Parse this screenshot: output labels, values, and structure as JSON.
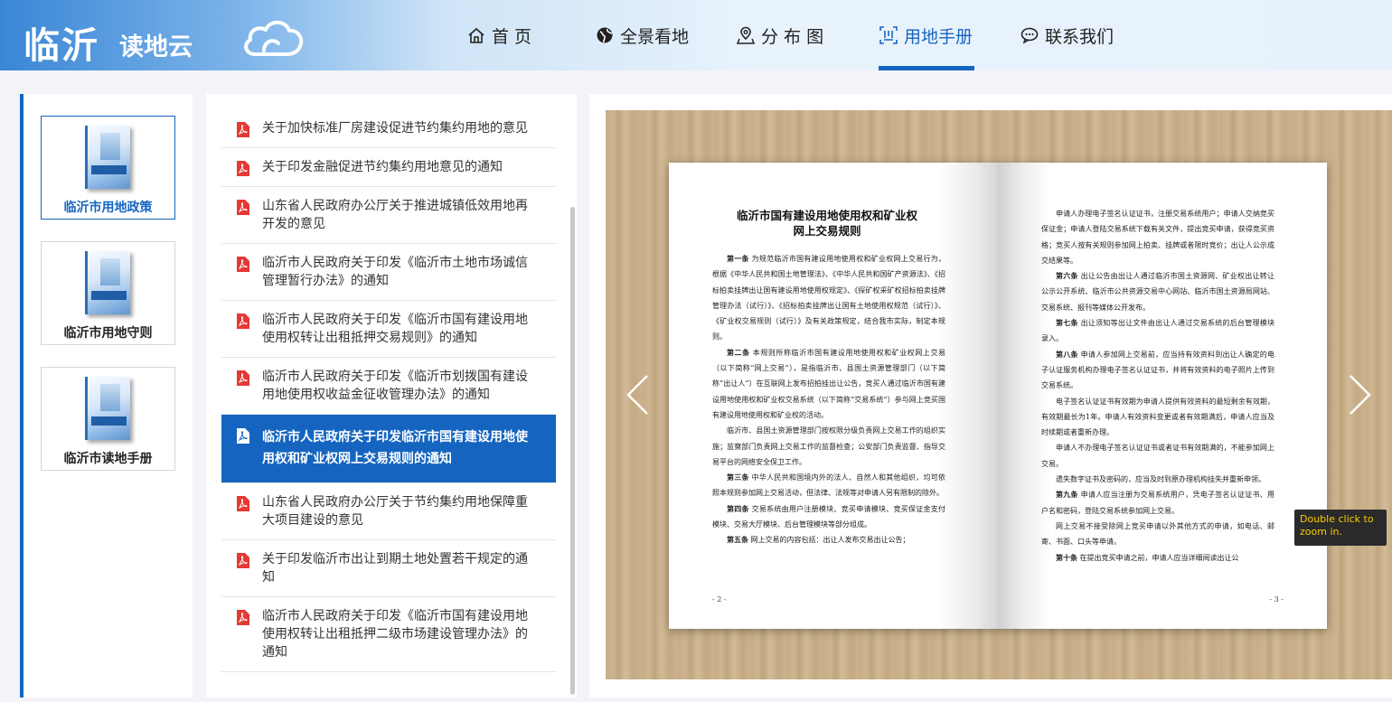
{
  "logo": {
    "main": "临沂",
    "sub": "读地云"
  },
  "nav": [
    {
      "label": "首 页",
      "icon": "home-icon"
    },
    {
      "label": "全景看地",
      "icon": "globe-icon"
    },
    {
      "label": "分 布 图",
      "icon": "location-pin-icon"
    },
    {
      "label": "用地手册",
      "icon": "book-scan-icon",
      "active": true
    },
    {
      "label": "联系我们",
      "icon": "chat-icon"
    }
  ],
  "categories": [
    {
      "label": "临沂市用地政策",
      "active": true
    },
    {
      "label": "临沂市用地守则"
    },
    {
      "label": "临沂市读地手册"
    }
  ],
  "documents": [
    {
      "title": "关于加快标准厂房建设促进节约集约用地的意见"
    },
    {
      "title": "关于印发金融促进节约集约用地意见的通知"
    },
    {
      "title": "山东省人民政府办公厅关于推进城镇低效用地再开发的意见"
    },
    {
      "title": "临沂市人民政府关于印发《临沂市土地市场诚信管理暂行办法》的通知"
    },
    {
      "title": "临沂市人民政府关于印发《临沂市国有建设用地使用权转让出租抵押交易规则》的通知"
    },
    {
      "title": "临沂市人民政府关于印发《临沂市划拨国有建设用地使用权收益金征收管理办法》的通知"
    },
    {
      "title": "临沂市人民政府关于印发临沂市国有建设用地使用权和矿业权网上交易规则的通知",
      "active": true
    },
    {
      "title": "山东省人民政府办公厅关于节约集约用地保障重大项目建设的意见"
    },
    {
      "title": "关于印发临沂市出让到期土地处置若干规定的通知"
    },
    {
      "title": "临沂市人民政府关于印发《临沂市国有建设用地使用权转让出租抵押二级市场建设管理办法》的通知"
    }
  ],
  "viewer": {
    "left_page": {
      "title_line1": "临沂市国有建设用地使用权和矿业权",
      "title_line2": "网上交易规则",
      "paragraphs": [
        {
          "lead": "第一条",
          "text": "为规范临沂市国有建设用地使用权和矿业权网上交易行为，根据《中华人民共和国土地管理法》、《中华人民共和国矿产资源法》、《招标拍卖挂牌出让国有建设用地使用权规定》、《探矿权采矿权招标拍卖挂牌管理办法（试行）》、《招标拍卖挂牌出让国有土地使用权规范（试行）》、《矿业权交易规则（试行）》及有关政策规定，结合我市实际，制定本规则。"
        },
        {
          "lead": "第二条",
          "text": "本规则所称临沂市国有建设用地使用权和矿业权网上交易（以下简称“网上交易”），是指临沂市、县国土资源管理部门（以下简称“出让人”）在互联网上发布招拍挂出让公告，竞买人通过临沂市国有建设用地使用权和矿业权交易系统（以下简称“交易系统”）参与网上竞买国有建设用地使用权和矿业权的活动。"
        },
        {
          "lead": "",
          "text": "临沂市、县国土资源管理部门按权限分级负责网上交易工作的组织实施；监察部门负责网上交易工作的监督检查；公安部门负责监督、指导交易平台的网络安全保卫工作。"
        },
        {
          "lead": "第三条",
          "text": "中华人民共和国境内外的法人、自然人和其他组织，均可依照本规则参加网上交易活动，但法律、法规等对申请人另有限制的除外。"
        },
        {
          "lead": "第四条",
          "text": "交易系统由用户注册模块、竞买申请模块、竞买保证金支付模块、交易大厅模块、后台管理模块等部分组成。"
        },
        {
          "lead": "第五条",
          "text": "网上交易的内容包括：出让人发布交易出让公告；"
        }
      ],
      "page_number": "- 2 -"
    },
    "right_page": {
      "paragraphs": [
        {
          "lead": "",
          "text": "申请人办理电子签名认证证书，注册交易系统用户；申请人交纳竞买保证金；申请人登陆交易系统下载有关文件，提出竞买申请，获得竞买资格；竞买人按有关规则参加网上拍卖、挂牌或者限时竞价；出让人公示成交结果等。"
        },
        {
          "lead": "第六条",
          "text": "出让公告由出让人通过临沂市国土资源网、矿业权出让转让公示公开系统、临沂市公共资源交易中心网站、临沂市国土资源局网站、交易系统、报刊等媒体公开发布。"
        },
        {
          "lead": "第七条",
          "text": "出让须知等出让文件由出让人通过交易系统的后台管理模块录入。"
        },
        {
          "lead": "第八条",
          "text": "申请人参加网上交易前，应当持有效资料到出让人确定的电子认证服务机构办理电子签名认证证书，并将有效资料的电子照片上传到交易系统。"
        },
        {
          "lead": "",
          "text": "电子签名认证证书有效期为申请人提供有效资料的最短剩余有效期，有效期最长为1年。申请人有效资料变更或者有效期满后，申请人应当及时续期或者重新办理。"
        },
        {
          "lead": "",
          "text": "申请人不办理电子签名认证证书或者证书有效期满的，不能参加网上交易。"
        },
        {
          "lead": "",
          "text": "遗失数字证书及密码的，应当及时到原办理机构挂失并重新申领。"
        },
        {
          "lead": "第九条",
          "text": "申请人应当注册为交易系统用户，凭电子签名认证证书、用户名和密码，登陆交易系统参加网上交易。"
        },
        {
          "lead": "",
          "text": "网上交易不接受除网上竞买申请以外其他方式的申请，如电话、邮寄、书面、口头等申请。"
        },
        {
          "lead": "第十条",
          "text": "在提出竞买申请之前，申请人应当详细阅读出让公"
        }
      ],
      "page_number": "- 3 -"
    },
    "tooltip": "Double click to zoom in."
  },
  "colors": {
    "accent": "#1565c0",
    "tooltip_text": "#ffcc00",
    "pdf_red": "#e53935"
  }
}
